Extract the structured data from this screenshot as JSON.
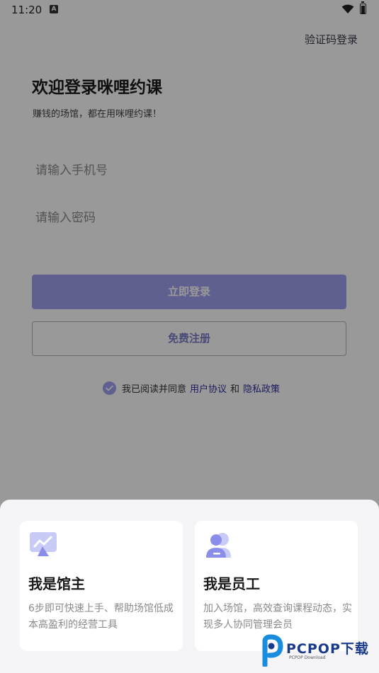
{
  "status_bar": {
    "time": "11:20",
    "notification_glyph": "A"
  },
  "header": {
    "sms_login": "验证码登录"
  },
  "welcome": {
    "title": "欢迎登录咪哩约课",
    "subtitle": "赚钱的场馆，都在用咪哩约课！"
  },
  "form": {
    "phone_placeholder": "请输入手机号",
    "password_placeholder": "请输入密码",
    "login_label": "立即登录",
    "register_label": "免费注册"
  },
  "agreement": {
    "prefix": "我已阅读并同意",
    "user_agreement": "用户协议",
    "and": "和",
    "privacy_policy": "隐私政策"
  },
  "role_sheet": {
    "owner": {
      "title": "我是馆主",
      "desc": "6步即可快速上手、帮助场馆低成本高盈利的经营工具"
    },
    "staff": {
      "title": "我是员工",
      "desc": "加入场馆，高效查询课程动态，实现多人协同管理会员"
    }
  },
  "watermark": {
    "brand": "PCPOP下载",
    "sub": "PCPOP Download"
  },
  "colors": {
    "accent": "#9ea0f0",
    "link": "#2d2f9a",
    "icon_light": "#c9cbf7",
    "icon_dark": "#8b8deb"
  }
}
